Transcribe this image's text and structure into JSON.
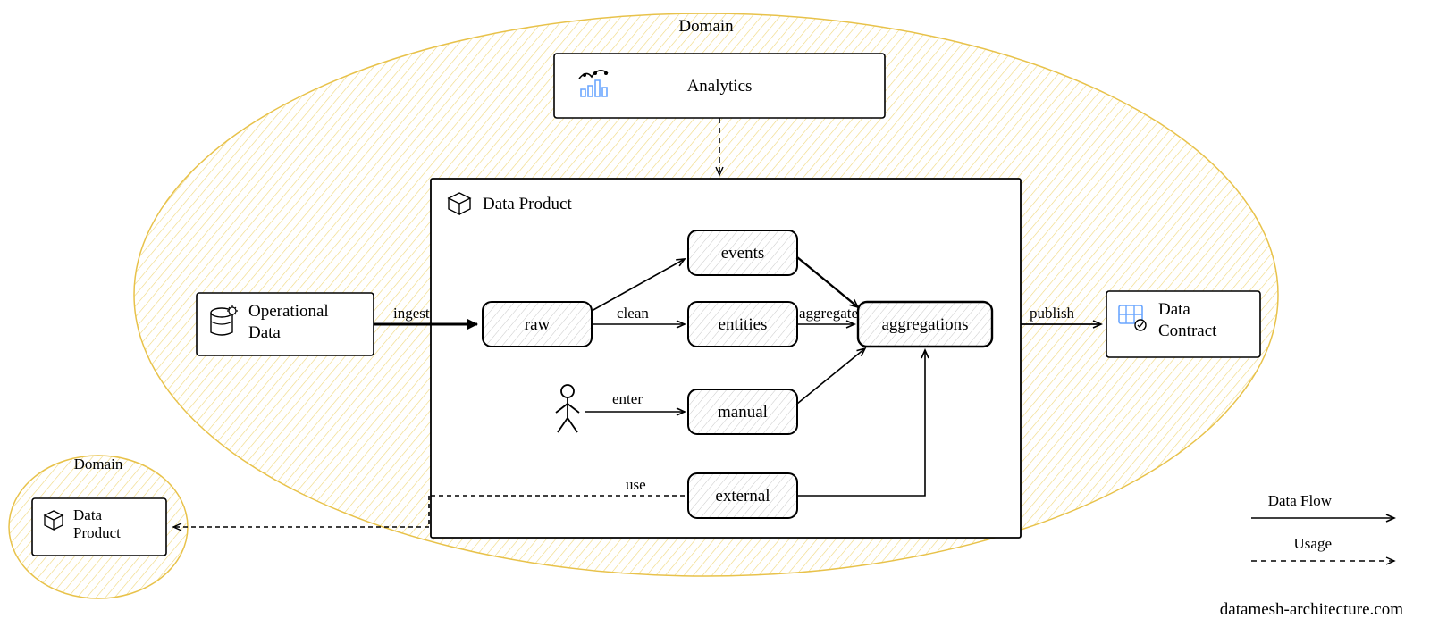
{
  "domains": {
    "main": {
      "label": "Domain"
    },
    "external": {
      "label": "Domain"
    }
  },
  "nodes": {
    "analytics": {
      "label": "Analytics"
    },
    "operational": {
      "label": "Operational\nData"
    },
    "data_product": {
      "label": "Data Product"
    },
    "raw": {
      "label": "raw"
    },
    "events": {
      "label": "events"
    },
    "entities": {
      "label": "entities"
    },
    "manual": {
      "label": "manual"
    },
    "external": {
      "label": "external"
    },
    "aggregations": {
      "label": "aggregations"
    },
    "data_contract": {
      "label": "Data\nContract"
    },
    "ext_data_product": {
      "label": "Data\nProduct"
    }
  },
  "edges": {
    "ingest": {
      "label": "ingest"
    },
    "clean": {
      "label": "clean"
    },
    "aggregate": {
      "label": "aggregate"
    },
    "enter": {
      "label": "enter"
    },
    "use": {
      "label": "use"
    },
    "publish": {
      "label": "publish"
    }
  },
  "legend": {
    "data_flow": "Data Flow",
    "usage": "Usage"
  },
  "attribution": "datamesh-architecture.com"
}
